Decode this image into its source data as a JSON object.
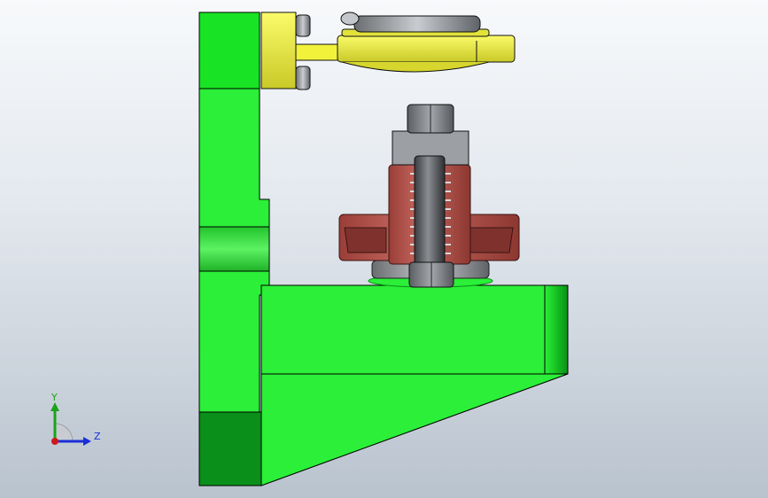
{
  "view": {
    "background_top": "#f7f9fb",
    "background_bottom": "#b9c3ce"
  },
  "model": {
    "bracket_color": "#2bef38",
    "bracket_shadow_color": "#0a8f1a",
    "clamp_arm_color": "#f2f23a",
    "spring_housing_color": "#b94f48",
    "screw_color": "#6d6f72",
    "nut_color": "#8a8d91"
  },
  "triad": {
    "y_label": "Y",
    "z_label": "Z",
    "y_color": "#1aa31a",
    "z_color": "#1a2fd6",
    "origin_color": "#d01818"
  }
}
